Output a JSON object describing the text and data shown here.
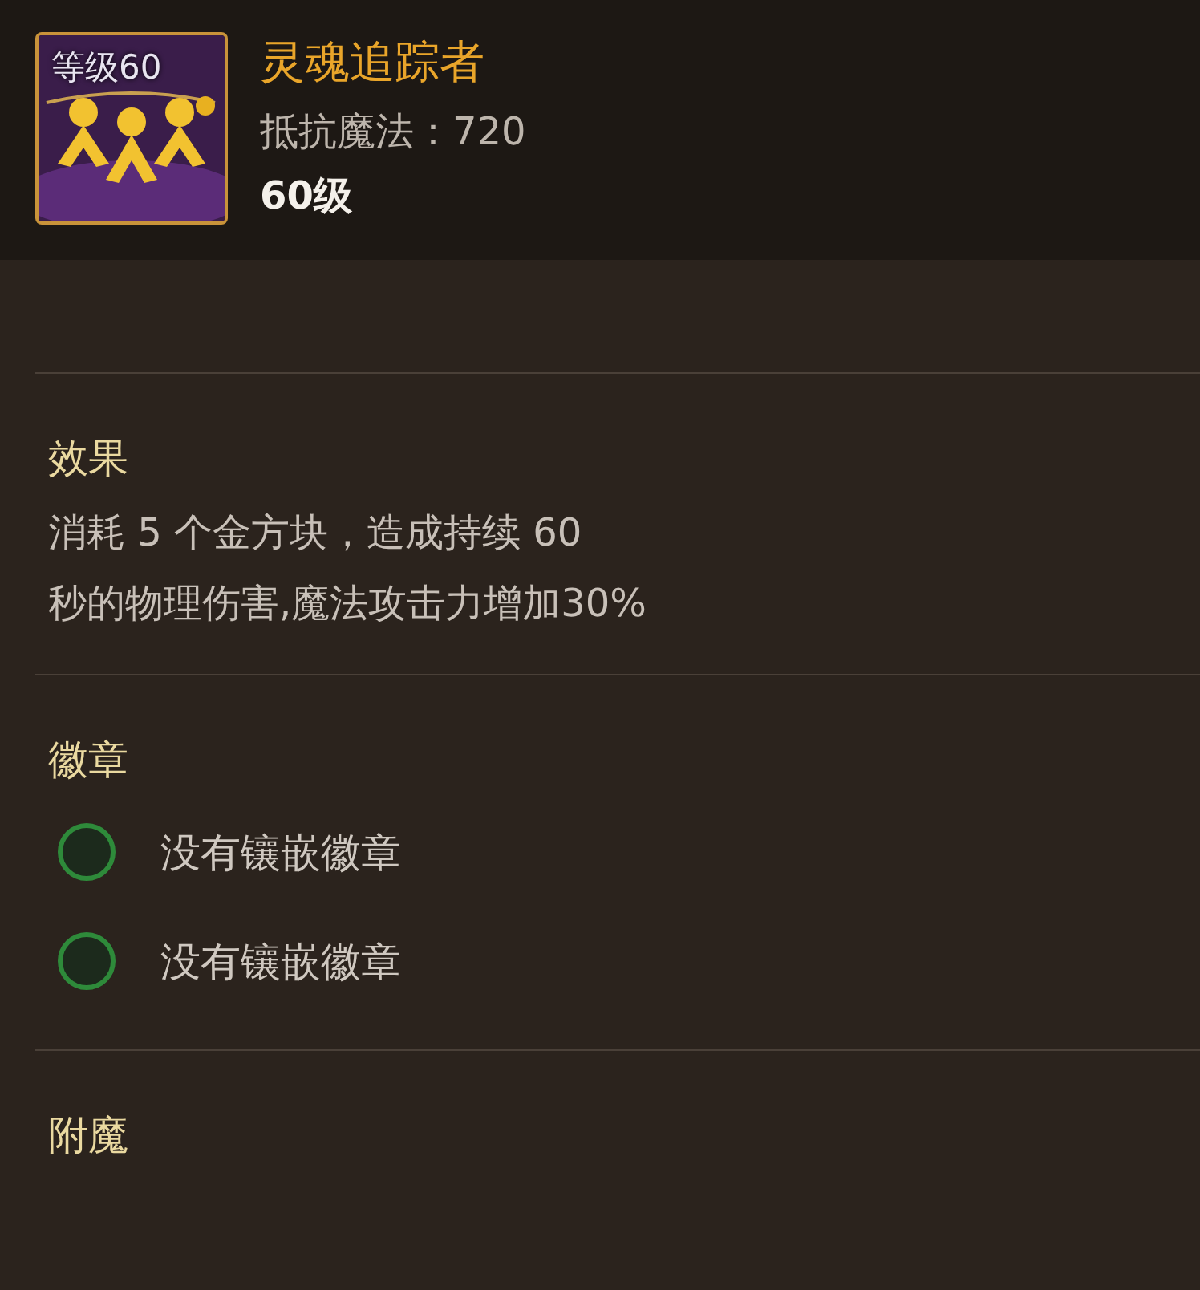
{
  "item": {
    "level_badge": "等级60",
    "name": "灵魂追踪者",
    "stat": "抵抗魔法：720",
    "level": "60级"
  },
  "sections": [
    {
      "kind": "text",
      "title": "效果",
      "lines": [
        "消耗 5 个金方块，造成持续 60",
        "秒的物理伤害,魔法攻击力增加30%"
      ]
    },
    {
      "kind": "slots",
      "title": "徽章",
      "slots": [
        {
          "label": "没有镶嵌徽章",
          "filled": false
        },
        {
          "label": "没有镶嵌徽章",
          "filled": false
        }
      ]
    },
    {
      "kind": "text",
      "title": "附魔"
    }
  ]
}
